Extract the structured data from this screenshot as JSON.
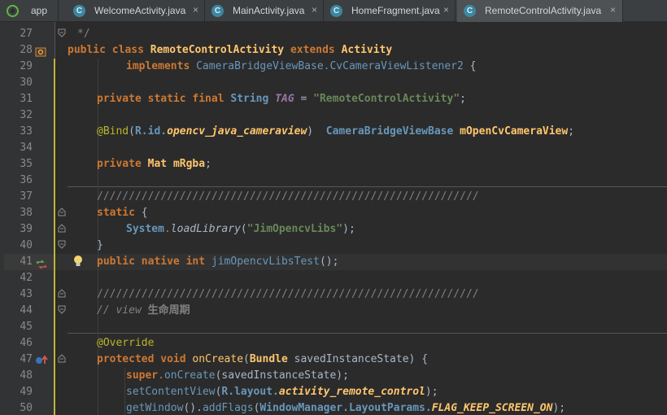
{
  "tabs": [
    {
      "label": "app",
      "icon": "android-app-icon",
      "active": false
    },
    {
      "label": "WelcomeActivity.java",
      "icon": "class-icon",
      "active": false
    },
    {
      "label": "MainActivity.java",
      "icon": "class-icon",
      "active": false
    },
    {
      "label": "HomeFragment.java",
      "icon": "class-icon",
      "active": false
    },
    {
      "label": "RemoteControlActivity.java",
      "icon": "class-icon",
      "active": true
    }
  ],
  "tab_close_glyph": "×",
  "tab_icon_letter": "C",
  "line_numbers": [
    "27",
    "28",
    "29",
    "30",
    "31",
    "32",
    "33",
    "34",
    "35",
    "36",
    "37",
    "38",
    "39",
    "40",
    "41",
    "42",
    "43",
    "44",
    "45",
    "46",
    "47",
    "48",
    "49",
    "50"
  ],
  "code": {
    "l27": "*/",
    "l28_public": "public",
    "l28_class": "class",
    "l28_name": "RemoteControlActivity",
    "l28_extends": "extends",
    "l28_parent": "Activity",
    "l29_implements": "implements",
    "l29_iface": "CameraBridgeViewBase.CvCameraViewListener2",
    "l29_brace": "{",
    "l31_mods": "private static final",
    "l31_type": "String",
    "l31_name": "TAG",
    "l31_eq": "=",
    "l31_value": "\"RemoteControlActivity\"",
    "l31_end": ";",
    "l33_ann": "@Bind",
    "l33_open": "(",
    "l33_ref": "R.id.",
    "l33_id": "opencv_java_cameraview",
    "l33_close": ")",
    "l33_type": "CameraBridgeViewBase",
    "l33_field": "mOpenCvCameraView",
    "l33_end": ";",
    "l35_mod": "private",
    "l35_type": "Mat",
    "l35_field": "mRgba",
    "l35_end": ";",
    "l37": "////////////////////////////////////////////////////////////",
    "l38_static": "static",
    "l38_brace": "{",
    "l39_cls": "System",
    "l39_dot": ".",
    "l39_fn": "loadLibrary",
    "l39_open": "(",
    "l39_str": "\"JimOpencvLibs\"",
    "l39_end": ");",
    "l40": "}",
    "l41_mods": "public native",
    "l41_type": "int",
    "l41_fn": "jimOpencvLibsTest",
    "l41_end": "();",
    "l43": "////////////////////////////////////////////////////////////",
    "l44_prefix": "// view",
    "l44_cn": "生命周期",
    "l46_ann": "@Override",
    "l47_mods": "protected void",
    "l47_fn": "onCreate",
    "l47_open": "(",
    "l47_type": "Bundle",
    "l47_param": "savedInstanceState",
    "l47_end": ") {",
    "l48_super": "super",
    "l48_dot": ".",
    "l48_fn": "onCreate",
    "l48_args": "(savedInstanceState);",
    "l49_fn": "setContentView",
    "l49_open": "(",
    "l49_ref": "R.layout.",
    "l49_id": "activity_remote_control",
    "l49_end": ");",
    "l50_fn": "getWindow",
    "l50_call": "().",
    "l50_fn2": "addFlags",
    "l50_open": "(",
    "l50_cls": "WindowManager.LayoutParams.",
    "l50_flag": "FLAG_KEEP_SCREEN_ON",
    "l50_end": ");"
  },
  "colors": {
    "keyword": "#cc7832",
    "class_name": "#ffc66d",
    "type": "#6897bb",
    "string": "#6a8759",
    "annotation": "#bbb529",
    "comment": "#808080",
    "background": "#2b2b2b"
  }
}
